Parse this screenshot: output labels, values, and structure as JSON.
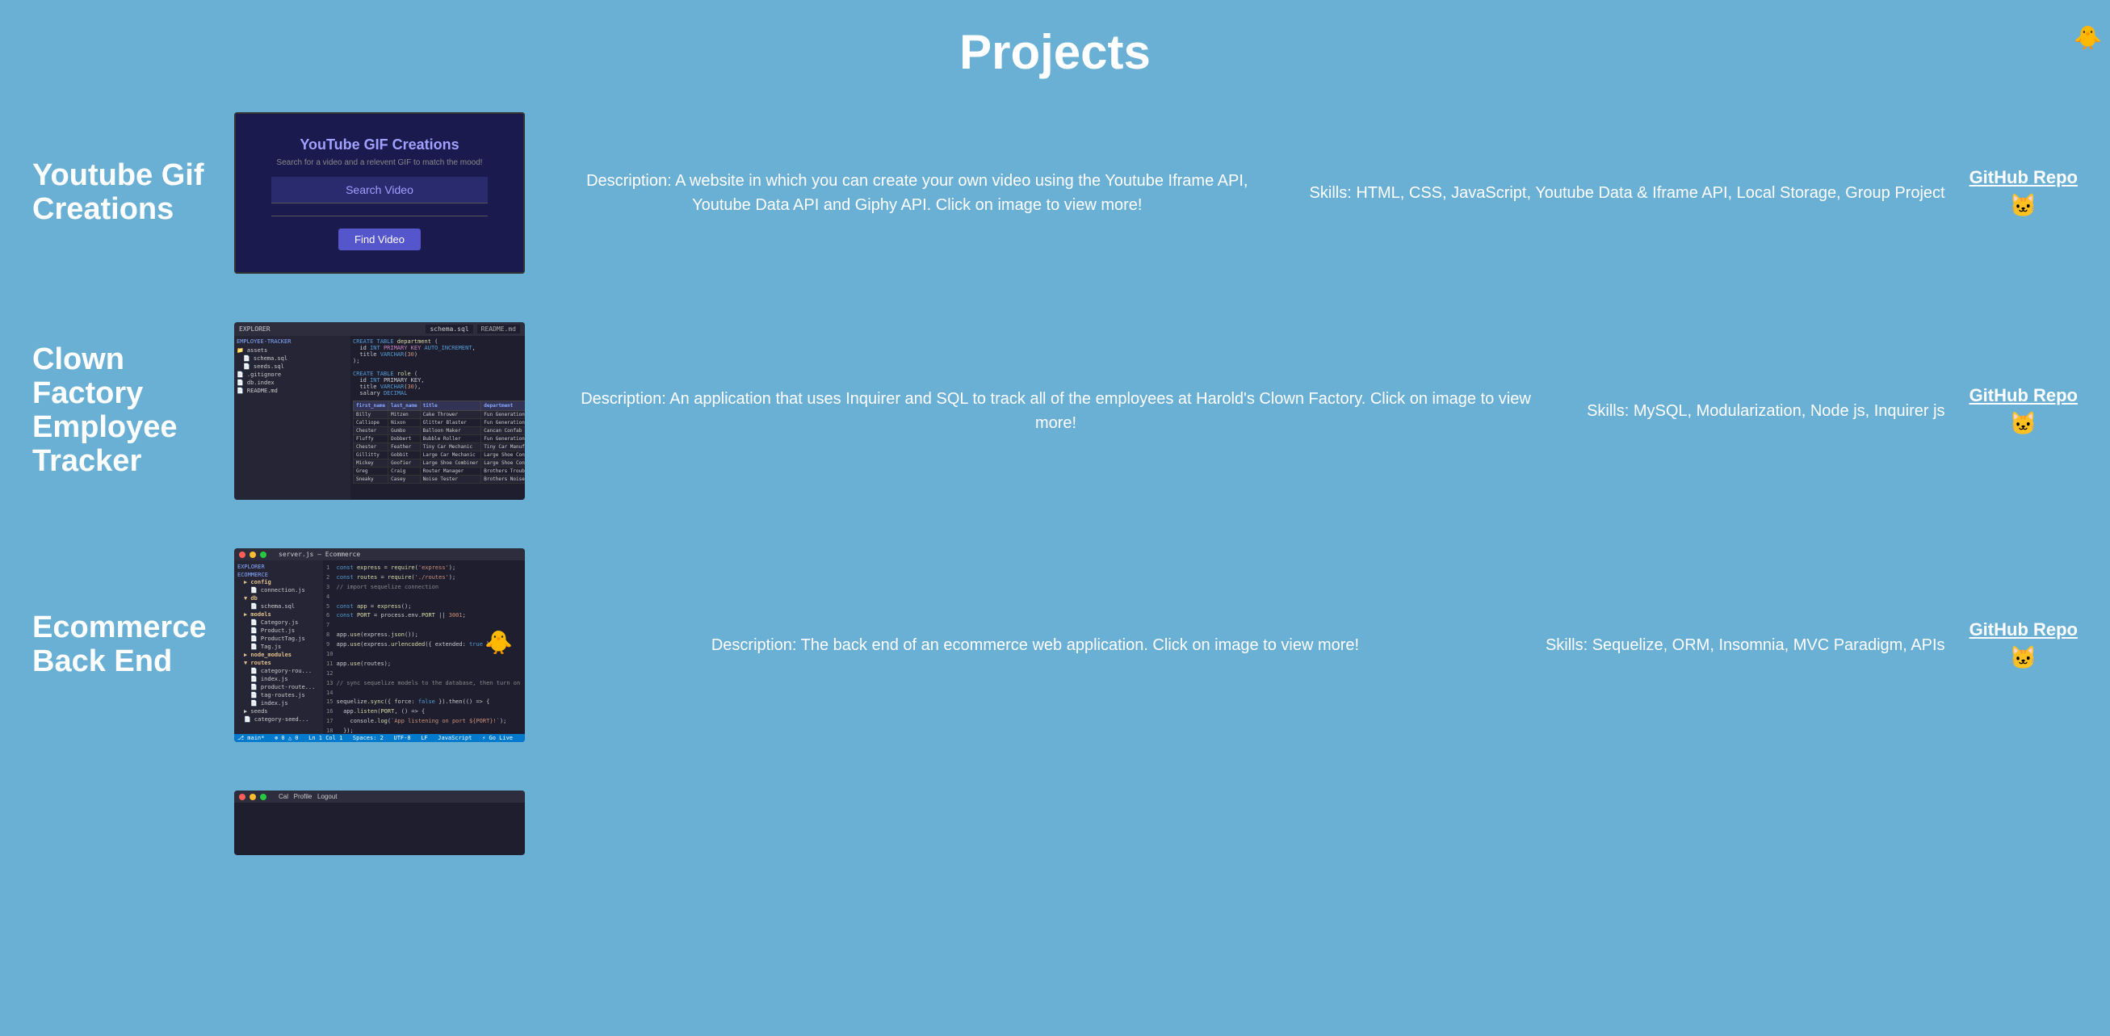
{
  "page": {
    "title": "Projects",
    "background_color": "#6ab0d4"
  },
  "projects": [
    {
      "id": "yt-gif",
      "title": "Youtube Gif Creations",
      "description": "Description: A website in which you can create your own video using the Youtube Iframe API, Youtube Data API and Giphy API. Click on image to view more!",
      "skills": "Skills: HTML, CSS, JavaScript, Youtube Data & Iframe API, Local Storage, Group Project",
      "github_label": "GitHub Repo",
      "github_emoji": "🐱",
      "preview_title": "YouTube GIF Creations",
      "preview_subtitle": "Search for a video and a relevent GIF to match the mood!",
      "preview_search": "Search Video",
      "preview_button": "Find Video"
    },
    {
      "id": "clown-factory",
      "title": "Clown Factory Employee Tracker",
      "description": "Description: An application that uses Inquirer and SQL to track all of the employees at Harold's Clown Factory. Click on image to view more!",
      "skills": "Skills: MySQL, Modularization, Node js, Inquirer js",
      "github_label": "GitHub Repo",
      "github_emoji": "🐱"
    },
    {
      "id": "ecommerce",
      "title": "Ecommerce Back End",
      "description": "Description: The back end of an ecommerce web application. Click on image to view more!",
      "skills": "Skills: Sequelize, ORM, Insomnia, MVC Paradigm, APIs",
      "github_label": "GitHub Repo",
      "github_emoji": "🐱"
    }
  ]
}
